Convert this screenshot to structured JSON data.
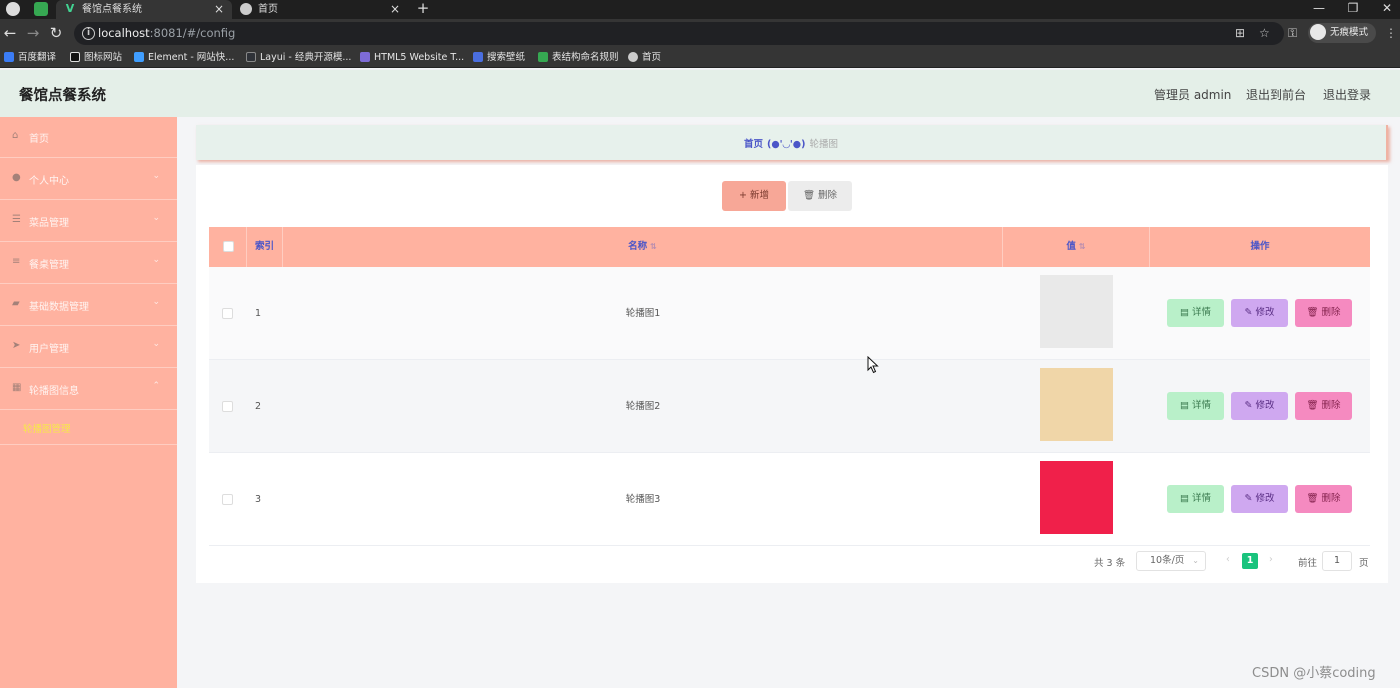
{
  "browser": {
    "tabs": [
      {
        "title": "餐馆点餐系统",
        "close": "×"
      },
      {
        "title": "首页",
        "close": "×"
      }
    ],
    "new_tab": "+",
    "url_host": "localhost",
    "url_rest": ":8081/#/config",
    "profile_label": "无痕模式",
    "bookmarks": [
      "百度翻译",
      "图标网站",
      "Element - 网站快...",
      "Layui - 经典开源模...",
      "HTML5 Website T...",
      "搜索壁纸",
      "表结构命名规则",
      "首页"
    ]
  },
  "header": {
    "title": "餐馆点餐系统",
    "admin_label": "管理员 admin",
    "front_link": "退出到前台",
    "logout_link": "退出登录"
  },
  "sidebar": {
    "items": [
      {
        "label": "首页",
        "icon": "home-icon"
      },
      {
        "label": "个人中心",
        "icon": "user-icon"
      },
      {
        "label": "菜品管理",
        "icon": "list-icon"
      },
      {
        "label": "餐桌管理",
        "icon": "menu-icon"
      },
      {
        "label": "基础数据管理",
        "icon": "box-icon"
      },
      {
        "label": "用户管理",
        "icon": "send-icon"
      },
      {
        "label": "轮播图信息",
        "icon": "grid-icon"
      }
    ],
    "active_sub": "轮播图管理"
  },
  "breadcrumb": {
    "home": "首页",
    "separator": "(●'◡'●)",
    "current": "轮播图"
  },
  "toolbar": {
    "add_label": "+ 新增",
    "delete_label": "🗑 删除"
  },
  "table": {
    "columns": {
      "index": "索引",
      "name": "名称",
      "value": "值",
      "actions": "操作"
    },
    "rows": [
      {
        "index": "1",
        "name": "轮播图1",
        "thumb_color": "#e9e9e9"
      },
      {
        "index": "2",
        "name": "轮播图2",
        "thumb_color": "#f0d6a8"
      },
      {
        "index": "3",
        "name": "轮播图3",
        "thumb_color": "#f0204a"
      }
    ],
    "actions": {
      "detail": "详情",
      "edit": "修改",
      "delete": "删除"
    }
  },
  "pagination": {
    "total": "共 3 条",
    "page_size": "10条/页",
    "current_page": "1",
    "goto_label": "前往",
    "goto_value": "1",
    "unit": "页"
  },
  "watermark": "CSDN @小蔡coding",
  "colors": {
    "sidebar": "#ffb2a0",
    "header": "#e4efe8",
    "accent": "#4b56c8",
    "pager_active": "#19c37d"
  }
}
